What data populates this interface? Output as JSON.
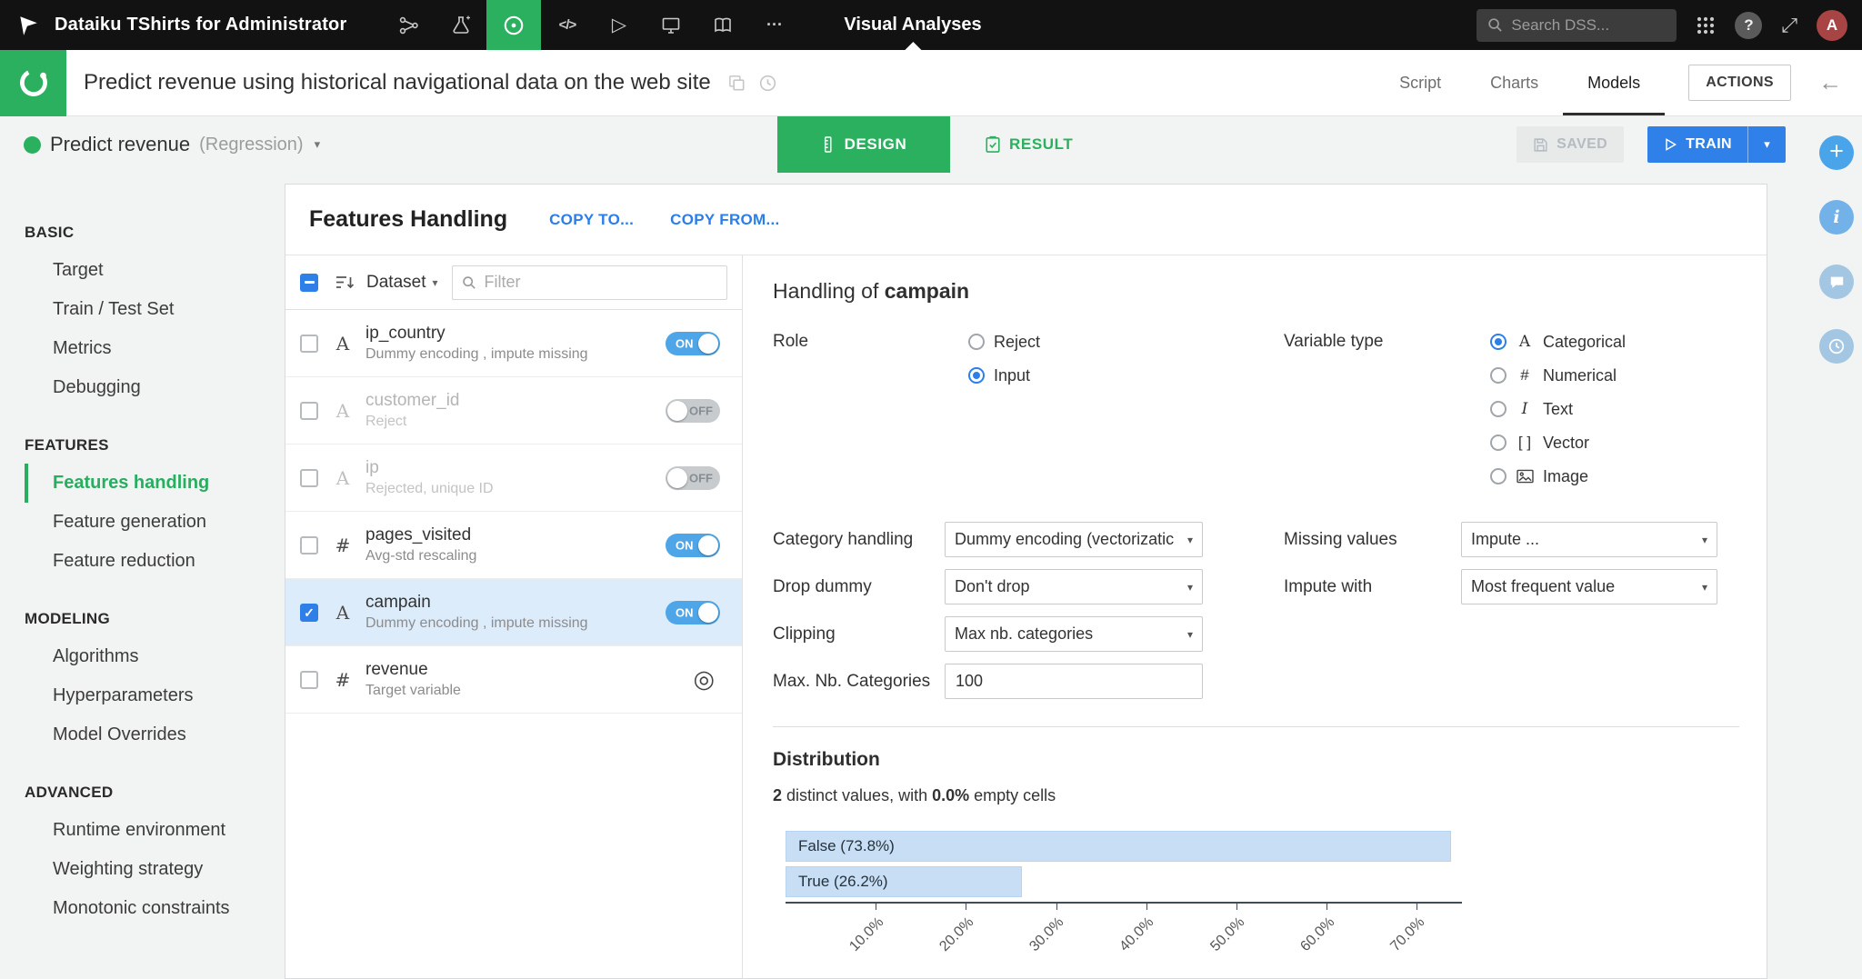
{
  "colors": {
    "accent_green": "#2AB05E",
    "accent_blue": "#2E7FE8",
    "toggle_blue": "#4EA6E8",
    "selected_row": "#DDECFB",
    "bar_fill": "#C7DEF5"
  },
  "icons": {
    "code": "</>",
    "play": "▷",
    "more": "···",
    "caret_down": "▾",
    "external": "⤢",
    "question": "?",
    "back_arrow": "←",
    "target": "◎",
    "plus": "+",
    "info": "i",
    "avatar_initial": "A"
  },
  "topbar": {
    "app_title": "Dataiku TShirts for Administrator",
    "section_label": "Visual Analyses",
    "search_placeholder": "Search DSS..."
  },
  "title_bar": {
    "title": "Predict revenue using historical navigational data on the web site",
    "tabs": [
      {
        "label": "Script",
        "active": "false"
      },
      {
        "label": "Charts",
        "active": "false"
      },
      {
        "label": "Models",
        "active": "true"
      }
    ],
    "actions_button": "ACTIONS"
  },
  "model_bar": {
    "model_name": "Predict revenue",
    "model_type": "(Regression)",
    "design_button": "DESIGN",
    "result_button": "RESULT",
    "saved_button": "SAVED",
    "train_button": "TRAIN"
  },
  "sidebar": {
    "sections": [
      {
        "title": "BASIC",
        "items": [
          {
            "label": "Target",
            "active": "false"
          },
          {
            "label": "Train / Test Set",
            "active": "false"
          },
          {
            "label": "Metrics",
            "active": "false"
          },
          {
            "label": "Debugging",
            "active": "false"
          }
        ]
      },
      {
        "title": "FEATURES",
        "items": [
          {
            "label": "Features handling",
            "active": "true"
          },
          {
            "label": "Feature generation",
            "active": "false"
          },
          {
            "label": "Feature reduction",
            "active": "false"
          }
        ]
      },
      {
        "title": "MODELING",
        "items": [
          {
            "label": "Algorithms",
            "active": "false"
          },
          {
            "label": "Hyperparameters",
            "active": "false"
          },
          {
            "label": "Model Overrides",
            "active": "false"
          }
        ]
      },
      {
        "title": "ADVANCED",
        "items": [
          {
            "label": "Runtime environment",
            "active": "false"
          },
          {
            "label": "Weighting strategy",
            "active": "false"
          },
          {
            "label": "Monotonic constraints",
            "active": "false"
          }
        ]
      }
    ]
  },
  "features_panel": {
    "title": "Features Handling",
    "copy_to": "COPY TO...",
    "copy_from": "COPY FROM...",
    "select_all_state": "mixed",
    "dataset_dropdown": "Dataset",
    "filter_placeholder": "Filter",
    "rows": [
      {
        "type": "A",
        "name": "ip_country",
        "desc": "Dummy encoding , impute missing",
        "toggle": "ON",
        "checked": "false",
        "muted": "false",
        "selected": "false"
      },
      {
        "type": "A",
        "name": "customer_id",
        "desc": "Reject",
        "toggle": "OFF",
        "checked": "false",
        "muted": "true",
        "selected": "false"
      },
      {
        "type": "A",
        "name": "ip",
        "desc": "Rejected, unique ID",
        "toggle": "OFF",
        "checked": "false",
        "muted": "true",
        "selected": "false"
      },
      {
        "type": "#",
        "name": "pages_visited",
        "desc": "Avg-std rescaling",
        "toggle": "ON",
        "checked": "false",
        "muted": "false",
        "selected": "false"
      },
      {
        "type": "A",
        "name": "campain",
        "desc": "Dummy encoding , impute missing",
        "toggle": "ON",
        "checked": "true",
        "muted": "false",
        "selected": "true"
      },
      {
        "type": "#",
        "name": "revenue",
        "desc": "Target variable",
        "checked": "false",
        "muted": "false",
        "selected": "false"
      }
    ]
  },
  "handling": {
    "title_prefix": "Handling of",
    "feature_name": "campain",
    "role": {
      "label": "Role",
      "options": [
        {
          "label": "Reject",
          "selected": "false"
        },
        {
          "label": "Input",
          "selected": "true"
        }
      ]
    },
    "variable_type": {
      "label": "Variable type",
      "options": [
        {
          "icon": "A",
          "label": "Categorical",
          "selected": "true"
        },
        {
          "icon": "#",
          "label": "Numerical",
          "selected": "false"
        },
        {
          "icon": "I",
          "label": "Text",
          "selected": "false"
        },
        {
          "icon": "[ ]",
          "label": "Vector",
          "selected": "false"
        },
        {
          "icon": "",
          "label": "Image",
          "selected": "false"
        }
      ]
    },
    "form": {
      "category_handling": {
        "label": "Category handling",
        "value": "Dummy encoding (vectorizatic"
      },
      "missing_values": {
        "label": "Missing values",
        "value": "Impute ..."
      },
      "drop_dummy": {
        "label": "Drop dummy",
        "value": "Don't drop"
      },
      "impute_with": {
        "label": "Impute with",
        "value": "Most frequent value"
      },
      "clipping": {
        "label": "Clipping",
        "value": "Max nb. categories"
      },
      "max_categories": {
        "label": "Max. Nb. Categories",
        "value": "100"
      }
    }
  },
  "distribution": {
    "title": "Distribution",
    "summary": {
      "count": "2",
      "mid": " distinct values, with ",
      "pct": "0.0%",
      "end": " empty cells"
    }
  },
  "chart_data": {
    "type": "bar",
    "orientation": "horizontal",
    "title": "Distribution",
    "categories": [
      "False",
      "True"
    ],
    "values": [
      73.8,
      26.2
    ],
    "bar_labels": [
      "False (73.8%)",
      "True (26.2%)"
    ],
    "unit": "%",
    "xlim": [
      0,
      75
    ],
    "x_ticks": [
      {
        "value": 10,
        "label": "10.0%"
      },
      {
        "value": 20,
        "label": "20.0%"
      },
      {
        "value": 30,
        "label": "30.0%"
      },
      {
        "value": 40,
        "label": "40.0%"
      },
      {
        "value": 50,
        "label": "50.0%"
      },
      {
        "value": 60,
        "label": "60.0%"
      },
      {
        "value": 70,
        "label": "70.0%"
      }
    ],
    "bar_color": "#C7DEF5",
    "grid": false,
    "legend": false
  }
}
